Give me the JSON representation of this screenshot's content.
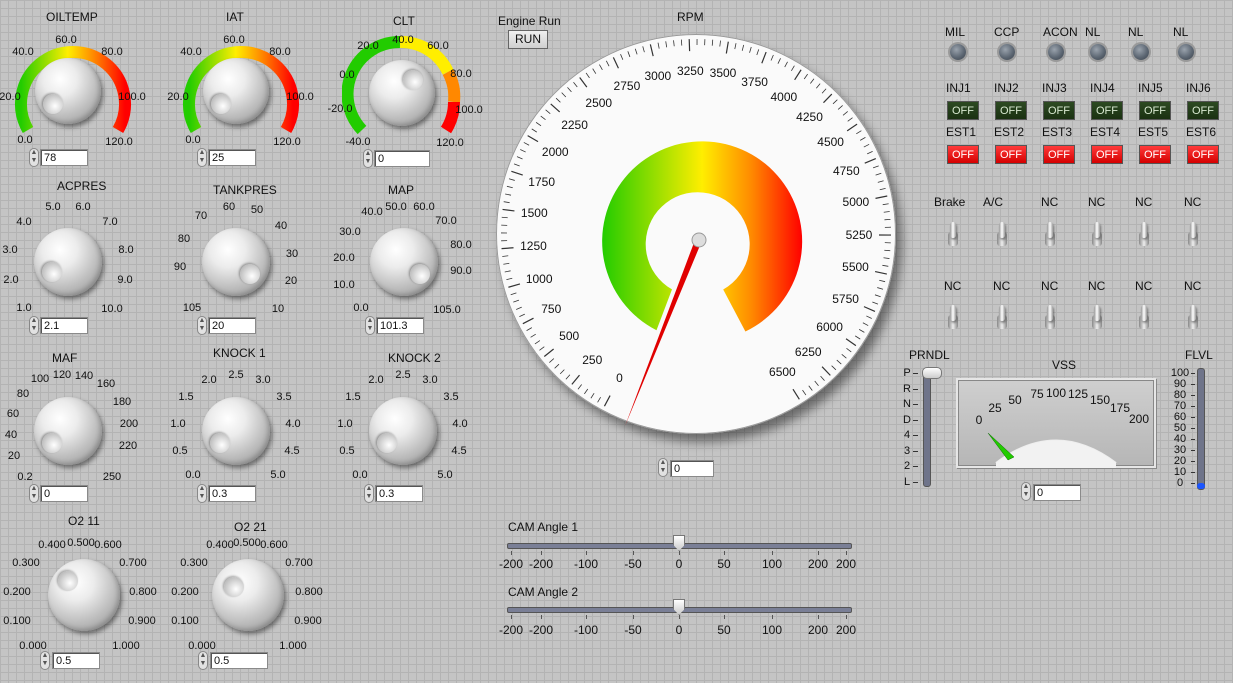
{
  "gauges": [
    {
      "id": "oiltemp",
      "label": "OILTEMP",
      "ticks": [
        "0.0",
        "20.0",
        "40.0",
        "60.0",
        "80.0",
        "100.0",
        "120.0"
      ],
      "value": "78"
    },
    {
      "id": "iat",
      "label": "IAT",
      "ticks": [
        "0.0",
        "20.0",
        "40.0",
        "60.0",
        "80.0",
        "100.0",
        "120.0"
      ],
      "value": "25"
    },
    {
      "id": "clt",
      "label": "CLT",
      "ticks": [
        "-40.0",
        "-20.0",
        "0.0",
        "20.0",
        "40.0",
        "60.0",
        "80.0",
        "100.0",
        "120.0"
      ],
      "value": "0"
    }
  ],
  "knobs": [
    {
      "id": "acpres",
      "label": "ACPRES",
      "ticks": [
        "1.0",
        "2.0",
        "3.0",
        "4.0",
        "5.0",
        "6.0",
        "7.0",
        "8.0",
        "9.0",
        "10.0"
      ],
      "value": "2.1"
    },
    {
      "id": "tankpres",
      "label": "TANKPRES",
      "ticks": [
        "105",
        "90",
        "80",
        "70",
        "60",
        "50",
        "40",
        "30",
        "20",
        "10"
      ],
      "value": "20"
    },
    {
      "id": "map",
      "label": "MAP",
      "ticks": [
        "0.0",
        "10.0",
        "20.0",
        "30.0",
        "40.0",
        "50.0",
        "60.0",
        "70.0",
        "80.0",
        "90.0",
        "105.0"
      ],
      "value": "101.3"
    },
    {
      "id": "maf",
      "label": "MAF",
      "ticks": [
        "0.2",
        "20",
        "40",
        "60",
        "80",
        "100",
        "120",
        "140",
        "160",
        "180",
        "200",
        "220",
        "250"
      ],
      "value": "0"
    },
    {
      "id": "knock1",
      "label": "KNOCK 1",
      "ticks": [
        "0.0",
        "0.5",
        "1.0",
        "1.5",
        "2.0",
        "2.5",
        "3.0",
        "3.5",
        "4.0",
        "4.5",
        "5.0"
      ],
      "value": "0.3"
    },
    {
      "id": "knock2",
      "label": "KNOCK 2",
      "ticks": [
        "0.0",
        "0.5",
        "1.0",
        "1.5",
        "2.0",
        "2.5",
        "3.0",
        "3.5",
        "4.0",
        "4.5",
        "5.0"
      ],
      "value": "0.3"
    },
    {
      "id": "o2_11",
      "label": "O2 11",
      "ticks": [
        "0.000",
        "0.100",
        "0.200",
        "0.300",
        "0.400",
        "0.500",
        "0.600",
        "0.700",
        "0.800",
        "0.900",
        "1.000"
      ],
      "value": "0.5"
    },
    {
      "id": "o2_21",
      "label": "O2 21",
      "ticks": [
        "0.000",
        "0.100",
        "0.200",
        "0.300",
        "0.400",
        "0.500",
        "0.600",
        "0.700",
        "0.800",
        "0.900",
        "1.000"
      ],
      "value": "0.5"
    }
  ],
  "engine_run": {
    "label": "Engine Run",
    "button": "RUN"
  },
  "rpm": {
    "label": "RPM",
    "ticks": [
      "0",
      "250",
      "500",
      "750",
      "1000",
      "1250",
      "1500",
      "1750",
      "2000",
      "2250",
      "2500",
      "2750",
      "3000",
      "3250",
      "3500",
      "3750",
      "4000",
      "4250",
      "4500",
      "4750",
      "5000",
      "5250",
      "5500",
      "5750",
      "6000",
      "6250",
      "6500"
    ],
    "value": "0"
  },
  "cam1": {
    "label": "CAM Angle 1",
    "ticks": [
      "-200",
      "-200",
      "-100",
      "-50",
      "0",
      "50",
      "100",
      "200",
      "200"
    ],
    "value": 0
  },
  "cam2": {
    "label": "CAM Angle 2",
    "ticks": [
      "-200",
      "-200",
      "-100",
      "-50",
      "0",
      "50",
      "100",
      "200",
      "200"
    ],
    "value": 0
  },
  "status_lights": [
    {
      "label": "MIL"
    },
    {
      "label": "CCP"
    },
    {
      "label": "ACON"
    },
    {
      "label": "NL"
    },
    {
      "label": "NL"
    },
    {
      "label": "NL"
    }
  ],
  "injectors": [
    {
      "label": "INJ1",
      "state": "OFF"
    },
    {
      "label": "INJ2",
      "state": "OFF"
    },
    {
      "label": "INJ3",
      "state": "OFF"
    },
    {
      "label": "INJ4",
      "state": "OFF"
    },
    {
      "label": "INJ5",
      "state": "OFF"
    },
    {
      "label": "INJ6",
      "state": "OFF"
    }
  ],
  "ests": [
    {
      "label": "EST1",
      "state": "OFF"
    },
    {
      "label": "EST2",
      "state": "OFF"
    },
    {
      "label": "EST3",
      "state": "OFF"
    },
    {
      "label": "EST4",
      "state": "OFF"
    },
    {
      "label": "EST5",
      "state": "OFF"
    },
    {
      "label": "EST6",
      "state": "OFF"
    }
  ],
  "switches_row1": [
    {
      "label": "Brake"
    },
    {
      "label": "A/C"
    },
    {
      "label": "NC"
    },
    {
      "label": "NC"
    },
    {
      "label": "NC"
    },
    {
      "label": "NC"
    }
  ],
  "switches_row2": [
    {
      "label": "NC"
    },
    {
      "label": "NC"
    },
    {
      "label": "NC"
    },
    {
      "label": "NC"
    },
    {
      "label": "NC"
    },
    {
      "label": "NC"
    }
  ],
  "prndl": {
    "label": "PRNDL",
    "ticks": [
      "P",
      "R",
      "N",
      "D",
      "4",
      "3",
      "2",
      "L"
    ],
    "selected": "P"
  },
  "vss": {
    "label": "VSS",
    "ticks": [
      "0",
      "25",
      "50",
      "75",
      "100",
      "125",
      "150",
      "175",
      "200"
    ],
    "value": "0"
  },
  "flvl": {
    "label": "FLVL",
    "ticks": [
      "100",
      "90",
      "80",
      "70",
      "60",
      "50",
      "40",
      "30",
      "20",
      "10",
      "0"
    ],
    "value": 0
  },
  "colors": {
    "green": "#22cc00",
    "yellow": "#ffee00",
    "orange": "#ff8800",
    "red": "#ff0000",
    "off_green": "#1e3a16"
  }
}
